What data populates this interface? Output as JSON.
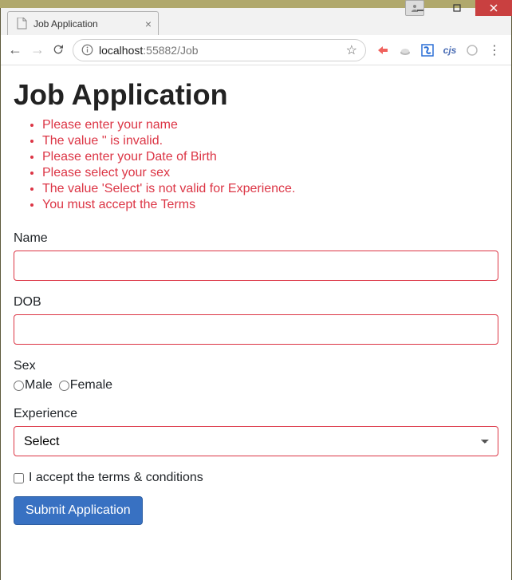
{
  "browser": {
    "tab_title": "Job Application",
    "url_host": "localhost",
    "url_port": ":55882",
    "url_path": "/Job"
  },
  "page": {
    "heading": "Job Application",
    "errors": [
      "Please enter your name",
      "The value '' is invalid.",
      "Please enter your Date of Birth",
      "Please select your sex",
      "The value 'Select' is not valid for Experience.",
      "You must accept the Terms"
    ],
    "name": {
      "label": "Name",
      "value": ""
    },
    "dob": {
      "label": "DOB",
      "value": ""
    },
    "sex": {
      "label": "Sex",
      "options": {
        "male": "Male",
        "female": "Female"
      },
      "selected": null
    },
    "experience": {
      "label": "Experience",
      "selected": "Select"
    },
    "terms": {
      "label": "I accept the terms & conditions",
      "checked": false
    },
    "submit_label": "Submit Application"
  },
  "extensions": {
    "cjs": "cjs"
  }
}
